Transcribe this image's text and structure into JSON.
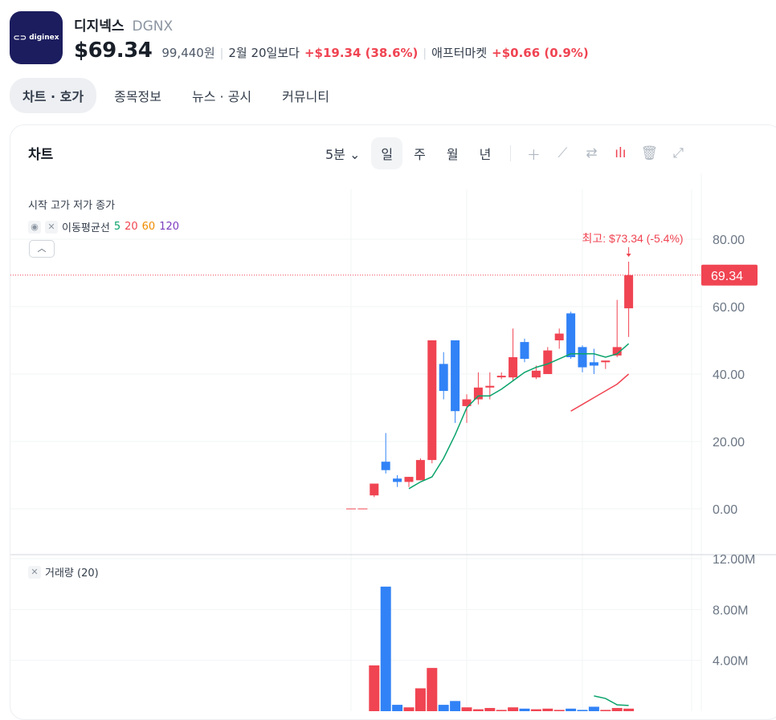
{
  "header": {
    "logo_text": "diginex",
    "logo_icon": "chain-link-icon",
    "name": "디지넥스",
    "ticker": "DGNX",
    "price": "$69.34",
    "price_krw": "99,440원",
    "compare_label": "2월 20일보다",
    "change": "+$19.34 (38.6%)",
    "aftermarket_label": "애프터마켓",
    "aftermarket_change": "+$0.66 (0.9%)"
  },
  "tabs": [
    {
      "label": "차트 · 호가",
      "active": true
    },
    {
      "label": "종목정보",
      "active": false
    },
    {
      "label": "뉴스 · 공시",
      "active": false
    },
    {
      "label": "커뮤니티",
      "active": false
    }
  ],
  "chart_card": {
    "title": "차트",
    "interval": "5분",
    "ranges": [
      "일",
      "주",
      "월",
      "년"
    ],
    "selected_range": "일",
    "tools": [
      "plus-icon",
      "pencil-icon",
      "compare-arrows-icon",
      "candle-type-icon",
      "trash-icon",
      "expand-icon"
    ],
    "ohlc_legend": "시작 고가 저가 종가",
    "ma_label": "이동평균선",
    "ma_periods": [
      "5",
      "20",
      "60",
      "120"
    ],
    "high_annotation": "최고: $73.34 (-5.4%)",
    "current_price_tag": "69.34",
    "volume_legend": "거래량 (20)"
  },
  "colors": {
    "up": "#f04452",
    "down": "#3182f6",
    "brand": "#1c1d5e",
    "ma5": "#0aa36b",
    "ma20": "#f04452"
  },
  "chart_data": [
    {
      "type": "candlestick",
      "title": "",
      "y_ticks": [
        "80.00",
        "60.00",
        "40.00",
        "20.00",
        "0.00"
      ],
      "ylim": [
        0,
        80
      ],
      "grid": true,
      "candles": [
        {
          "o": 0.0,
          "h": 0.0,
          "l": 0.0,
          "c": 0.0
        },
        {
          "o": 0.0,
          "h": 0.0,
          "l": 0.0,
          "c": 0.0
        },
        {
          "o": 4.0,
          "h": 7.5,
          "l": 3.5,
          "c": 7.5
        },
        {
          "o": 14.0,
          "h": 22.5,
          "l": 10.5,
          "c": 11.5
        },
        {
          "o": 9.0,
          "h": 10.0,
          "l": 6.5,
          "c": 8.0
        },
        {
          "o": 8.0,
          "h": 9.5,
          "l": 6.5,
          "c": 9.5
        },
        {
          "o": 8.5,
          "h": 15.0,
          "l": 8.5,
          "c": 14.5
        },
        {
          "o": 14.5,
          "h": 50.0,
          "l": 13.5,
          "c": 50.0
        },
        {
          "o": 43.0,
          "h": 46.5,
          "l": 32.5,
          "c": 35.0
        },
        {
          "o": 50.0,
          "h": 50.0,
          "l": 25.5,
          "c": 29.0
        },
        {
          "o": 30.5,
          "h": 34.0,
          "l": 25.5,
          "c": 32.5
        },
        {
          "o": 32.5,
          "h": 40.5,
          "l": 31.0,
          "c": 36.0
        },
        {
          "o": 36.0,
          "h": 40.5,
          "l": 32.5,
          "c": 36.5
        },
        {
          "o": 39.5,
          "h": 40.5,
          "l": 38.5,
          "c": 39.5
        },
        {
          "o": 39.0,
          "h": 53.5,
          "l": 38.0,
          "c": 45.0
        },
        {
          "o": 49.5,
          "h": 50.5,
          "l": 43.5,
          "c": 44.5
        },
        {
          "o": 39.0,
          "h": 42.5,
          "l": 38.5,
          "c": 41.0
        },
        {
          "o": 40.0,
          "h": 48.0,
          "l": 40.0,
          "c": 47.0
        },
        {
          "o": 50.0,
          "h": 53.5,
          "l": 47.5,
          "c": 52.0
        },
        {
          "o": 58.0,
          "h": 58.5,
          "l": 44.5,
          "c": 45.0
        },
        {
          "o": 48.0,
          "h": 48.5,
          "l": 40.5,
          "c": 42.0
        },
        {
          "o": 43.5,
          "h": 47.5,
          "l": 40.0,
          "c": 42.5
        },
        {
          "o": 43.5,
          "h": 44.0,
          "l": 41.5,
          "c": 44.0
        },
        {
          "o": 45.5,
          "h": 62.0,
          "l": 45.0,
          "c": 48.0
        },
        {
          "o": 59.5,
          "h": 73.34,
          "l": 51.0,
          "c": 69.34
        }
      ],
      "ma5": [
        null,
        null,
        null,
        null,
        null,
        6.0,
        8.0,
        9.5,
        15.0,
        22.0,
        30.0,
        33.5,
        33.5,
        35.5,
        38.0,
        40.5,
        42.0,
        43.0,
        44.5,
        46.0,
        46.0,
        46.0,
        45.0,
        46.0,
        49.0
      ],
      "ma20": [
        null,
        null,
        null,
        null,
        null,
        null,
        null,
        null,
        null,
        null,
        null,
        null,
        null,
        null,
        null,
        null,
        null,
        null,
        null,
        29.0,
        31.0,
        33.0,
        35.0,
        37.0,
        40.0
      ]
    },
    {
      "type": "bar",
      "title": "",
      "y_ticks": [
        "12.00M",
        "8.00M",
        "4.00M"
      ],
      "ylim": [
        0,
        12000000
      ],
      "values": [
        0,
        0,
        3600000,
        9800000,
        500000,
        300000,
        1800000,
        3400000,
        500000,
        800000,
        300000,
        150000,
        250000,
        100000,
        300000,
        200000,
        150000,
        200000,
        100000,
        200000,
        100000,
        350000,
        100000,
        250000,
        200000
      ],
      "ma": [
        null,
        null,
        null,
        null,
        null,
        null,
        null,
        null,
        null,
        null,
        null,
        null,
        null,
        null,
        null,
        null,
        null,
        null,
        null,
        null,
        null,
        1200000,
        1000000,
        500000,
        450000
      ]
    }
  ]
}
